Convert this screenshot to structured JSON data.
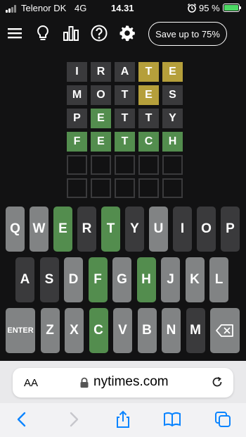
{
  "status_bar": {
    "carrier": "Telenor DK",
    "network": "4G",
    "time": "14.31",
    "battery_percent": "95 %"
  },
  "header": {
    "icons": [
      "menu-icon",
      "lightbulb-icon",
      "stats-icon",
      "help-icon",
      "settings-icon"
    ],
    "save_button_label": "Save up to 75%"
  },
  "board": {
    "rows": [
      [
        {
          "letter": "I",
          "state": "absent"
        },
        {
          "letter": "R",
          "state": "absent"
        },
        {
          "letter": "A",
          "state": "absent"
        },
        {
          "letter": "T",
          "state": "present"
        },
        {
          "letter": "E",
          "state": "present"
        }
      ],
      [
        {
          "letter": "M",
          "state": "absent"
        },
        {
          "letter": "O",
          "state": "absent"
        },
        {
          "letter": "T",
          "state": "absent"
        },
        {
          "letter": "E",
          "state": "present"
        },
        {
          "letter": "S",
          "state": "absent"
        }
      ],
      [
        {
          "letter": "P",
          "state": "absent"
        },
        {
          "letter": "E",
          "state": "correct"
        },
        {
          "letter": "T",
          "state": "absent"
        },
        {
          "letter": "T",
          "state": "absent"
        },
        {
          "letter": "Y",
          "state": "absent"
        }
      ],
      [
        {
          "letter": "F",
          "state": "correct"
        },
        {
          "letter": "E",
          "state": "correct"
        },
        {
          "letter": "T",
          "state": "correct"
        },
        {
          "letter": "C",
          "state": "correct"
        },
        {
          "letter": "H",
          "state": "correct"
        }
      ],
      [
        {
          "letter": "",
          "state": "empty"
        },
        {
          "letter": "",
          "state": "empty"
        },
        {
          "letter": "",
          "state": "empty"
        },
        {
          "letter": "",
          "state": "empty"
        },
        {
          "letter": "",
          "state": "empty"
        }
      ],
      [
        {
          "letter": "",
          "state": "empty"
        },
        {
          "letter": "",
          "state": "empty"
        },
        {
          "letter": "",
          "state": "empty"
        },
        {
          "letter": "",
          "state": "empty"
        },
        {
          "letter": "",
          "state": "empty"
        }
      ]
    ]
  },
  "keyboard": {
    "rows": [
      [
        {
          "label": "Q",
          "state": "unused"
        },
        {
          "label": "W",
          "state": "unused"
        },
        {
          "label": "E",
          "state": "correct"
        },
        {
          "label": "R",
          "state": "absent"
        },
        {
          "label": "T",
          "state": "correct"
        },
        {
          "label": "Y",
          "state": "absent"
        },
        {
          "label": "U",
          "state": "unused"
        },
        {
          "label": "I",
          "state": "absent"
        },
        {
          "label": "O",
          "state": "absent"
        },
        {
          "label": "P",
          "state": "absent"
        }
      ],
      [
        {
          "label": "A",
          "state": "absent"
        },
        {
          "label": "S",
          "state": "absent"
        },
        {
          "label": "D",
          "state": "unused"
        },
        {
          "label": "F",
          "state": "correct"
        },
        {
          "label": "G",
          "state": "unused"
        },
        {
          "label": "H",
          "state": "correct"
        },
        {
          "label": "J",
          "state": "unused"
        },
        {
          "label": "K",
          "state": "unused"
        },
        {
          "label": "L",
          "state": "unused"
        }
      ],
      [
        {
          "label": "ENTER",
          "state": "unused"
        },
        {
          "label": "Z",
          "state": "unused"
        },
        {
          "label": "X",
          "state": "unused"
        },
        {
          "label": "C",
          "state": "correct"
        },
        {
          "label": "V",
          "state": "unused"
        },
        {
          "label": "B",
          "state": "unused"
        },
        {
          "label": "N",
          "state": "unused"
        },
        {
          "label": "M",
          "state": "absent"
        },
        {
          "label": "",
          "state": "unused",
          "icon": "backspace-icon"
        }
      ]
    ]
  },
  "browser": {
    "text_size_label": "AA",
    "domain": "nytimes.com"
  },
  "toolbar": {
    "icons": [
      "back-icon",
      "forward-icon",
      "share-icon",
      "bookmarks-icon",
      "tabs-icon"
    ]
  },
  "colors": {
    "background": "#121213",
    "absent": "#3a3a3c",
    "present": "#b59f3b",
    "correct": "#538d4e",
    "unused_key": "#818384",
    "link_blue": "#0a84ff"
  }
}
